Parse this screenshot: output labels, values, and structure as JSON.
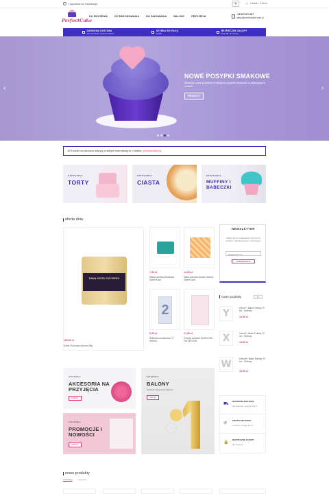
{
  "topbar": {
    "login_text": "Logowanie lub Rejestracja",
    "cart_text": "0 sztuk - 0,00 zł"
  },
  "header": {
    "logo_text": "PerfectCake",
    "nav": [
      "DO PIECZENIA",
      "DO DEKOROWANIA",
      "DO PAKOWANIA",
      "BALONY",
      "PRZYJĘCIA"
    ],
    "phone": "+48 537 879 877",
    "email": "sklep@perfectcake.com.pl"
  },
  "infobar": [
    {
      "title": "DARMOWA DOSTAWA",
      "sub": "dla zamówień powyżej 250 zł"
    },
    {
      "title": "SZYBKA WYSYŁKA",
      "sub": "w 24h"
    },
    {
      "title": "BEZPIECZNE ZAKUPY",
      "sub": "SSL dla. na strona"
    }
  ],
  "hero": {
    "title": "NOWE POSYPKI SMAKOWE",
    "text": "Sprawdź nowe produkty w kategorii posypek smakowe w atrakcyjnych cenach.",
    "button": "PRODUKTY",
    "slides": 4,
    "active_slide": 3
  },
  "promo": {
    "text": "10% zniżki na pierwsze zakupy w sklepie internetowym z kodem: ",
    "code": "pierwszezakupy"
  },
  "categories": [
    {
      "label": "KATEGORIA",
      "name": "TORTY"
    },
    {
      "label": "KATEGORIA",
      "name": "CIASTA"
    },
    {
      "label": "KATEGORIA",
      "name": "MUFFINY I BABECZKI"
    }
  ],
  "offer": {
    "title": "oferta dnia",
    "main_product": {
      "price": "169,00 zł",
      "name": "Dama 7kg masa cukrowa 5kg",
      "label": "DAMA PASTA ZUCCHERO"
    },
    "products": [
      {
        "price": "7,95 zł",
        "name": "Masa cukrowa turkusowa Sweet Kolor"
      },
      {
        "price": "16,95 zł",
        "name": "Masa cukrowa zestaw kolorów Sweet Kolor"
      },
      {
        "price": "5,95 zł",
        "name": "Świeczka urodzinowa \"2\" srebrna"
      },
      {
        "price": "17,95 zł",
        "name": "Ozdoby cukrowe SLODYCZE Tort DECOSK"
      }
    ]
  },
  "newsletter": {
    "title": "NEWSLETTER",
    "text": "Zapisz się do newslettera, aby być na bieżąco z aktualnościami i promocjami",
    "placeholder": "twoj@email.com",
    "button": "SUBSKRYBUJ"
  },
  "new_products_side": {
    "title": "nowe produkty",
    "items": [
      {
        "letter": "Y",
        "name": "Litera Y- Balon Foliowy 70 cm - Srebrny",
        "price": "12,50 zł"
      },
      {
        "letter": "X",
        "name": "Litera X- Balon Foliowy 70 cm - Srebrny",
        "price": "12,50 zł"
      },
      {
        "letter": "W",
        "name": "Litera W- Balon Foliowy 70 cm - Srebrny",
        "price": "12,50 zł"
      }
    ]
  },
  "tiles": [
    {
      "k": "KATEGORIA",
      "n": "AKCESORIA NA PRZYJĘCIA",
      "b": "ZOBACZ"
    },
    {
      "k": "KATEGORIA",
      "n": "BALONY",
      "s": "Sprawdź naszą ofertę balonów",
      "b": "WIĘCEJ"
    },
    {
      "k": "KATEGORIA",
      "n": "PROMOCJE I NOWOŚCI",
      "b": "ZOBACZ"
    }
  ],
  "features": [
    {
      "h": "DARMOWA DOSTAWA",
      "s": "dla zamówień powyżej 250 zł"
    },
    {
      "h": "PROSTE RETURNY",
      "s": "zwracasz w ciągu 14 dni"
    },
    {
      "h": "BEZPIECZNE ZAKUPY",
      "s": "dla zakupów"
    }
  ],
  "bottom": {
    "title": "nowe produkty",
    "tabs": [
      "bestsellery",
      "najnowsze"
    ],
    "active_tab": 1
  },
  "colors": {
    "accent": "#3d2fbf",
    "pink": "#e0357b"
  }
}
